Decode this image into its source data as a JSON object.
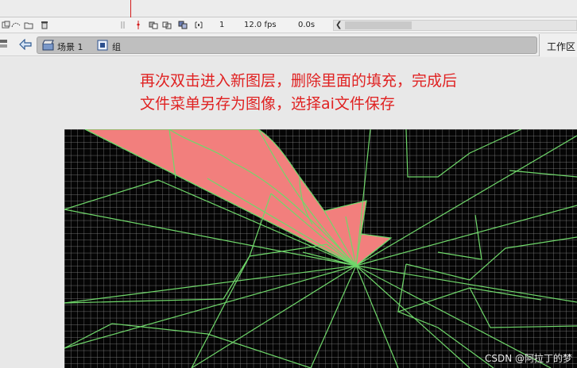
{
  "timeline": {
    "frame": "1",
    "fps": "12.0 fps",
    "time": "0.0s"
  },
  "editbar": {
    "crumbs": [
      "场景 1",
      "组"
    ],
    "workspace": "工作区"
  },
  "annotation": {
    "line1": "再次双击进入新图层，删除里面的填充，完成后",
    "line2": "文件菜单另存为图像，选择ai文件保存"
  },
  "canvas": {
    "background": "#050505",
    "grid_color": "#ffffff",
    "line_color": "#6fd86a",
    "fill_color": "#f27f7d"
  },
  "watermark": "CSDN @阿拉丁的梦"
}
